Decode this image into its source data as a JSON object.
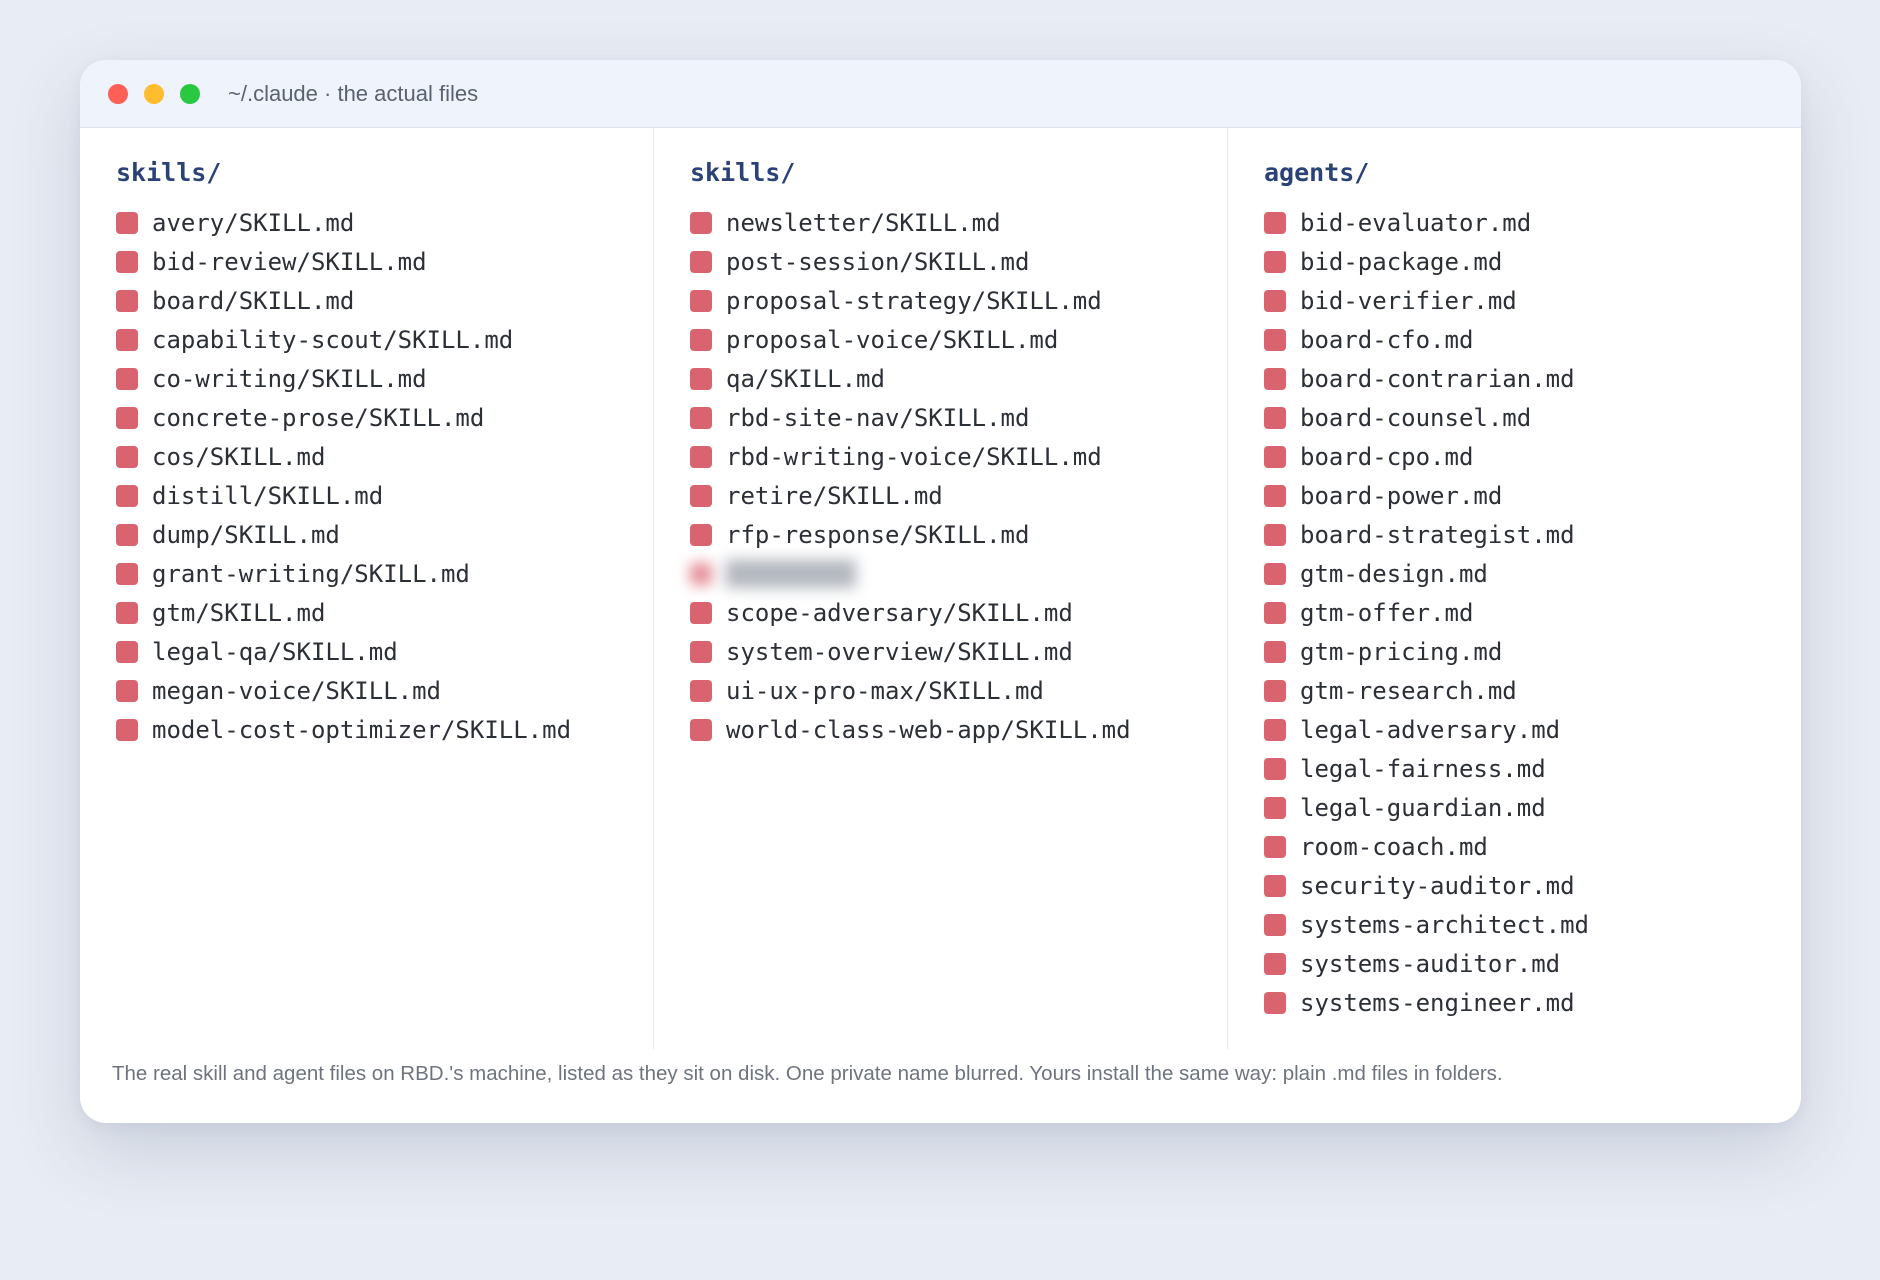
{
  "window": {
    "title": "~/.claude · the actual files",
    "colors": {
      "close": "#fe5f57",
      "minimize": "#febc2e",
      "maximize": "#28c840",
      "heading": "#2b4276",
      "file_icon": "#d9636f"
    }
  },
  "columns": [
    {
      "heading": "skills/",
      "files": [
        "avery/SKILL.md",
        "bid-review/SKILL.md",
        "board/SKILL.md",
        "capability-scout/SKILL.md",
        "co-writing/SKILL.md",
        "concrete-prose/SKILL.md",
        "cos/SKILL.md",
        "distill/SKILL.md",
        "dump/SKILL.md",
        "grant-writing/SKILL.md",
        "gtm/SKILL.md",
        "legal-qa/SKILL.md",
        "megan-voice/SKILL.md",
        "model-cost-optimizer/SKILL.md"
      ]
    },
    {
      "heading": "skills/",
      "files": [
        "newsletter/SKILL.md",
        "post-session/SKILL.md",
        "proposal-strategy/SKILL.md",
        "proposal-voice/SKILL.md",
        "qa/SKILL.md",
        "rbd-site-nav/SKILL.md",
        "rbd-writing-voice/SKILL.md",
        "retire/SKILL.md",
        "rfp-response/SKILL.md",
        "",
        "scope-adversary/SKILL.md",
        "system-overview/SKILL.md",
        "ui-ux-pro-max/SKILL.md",
        "world-class-web-app/SKILL.md"
      ],
      "blurred_index": 9
    },
    {
      "heading": "agents/",
      "files": [
        "bid-evaluator.md",
        "bid-package.md",
        "bid-verifier.md",
        "board-cfo.md",
        "board-contrarian.md",
        "board-counsel.md",
        "board-cpo.md",
        "board-power.md",
        "board-strategist.md",
        "gtm-design.md",
        "gtm-offer.md",
        "gtm-pricing.md",
        "gtm-research.md",
        "legal-adversary.md",
        "legal-fairness.md",
        "legal-guardian.md",
        "room-coach.md",
        "security-auditor.md",
        "systems-architect.md",
        "systems-auditor.md",
        "systems-engineer.md"
      ]
    }
  ],
  "footer": "The real skill and agent files on RBD.'s machine, listed as they sit on disk. One private name blurred. Yours install the same way: plain .md files in folders."
}
